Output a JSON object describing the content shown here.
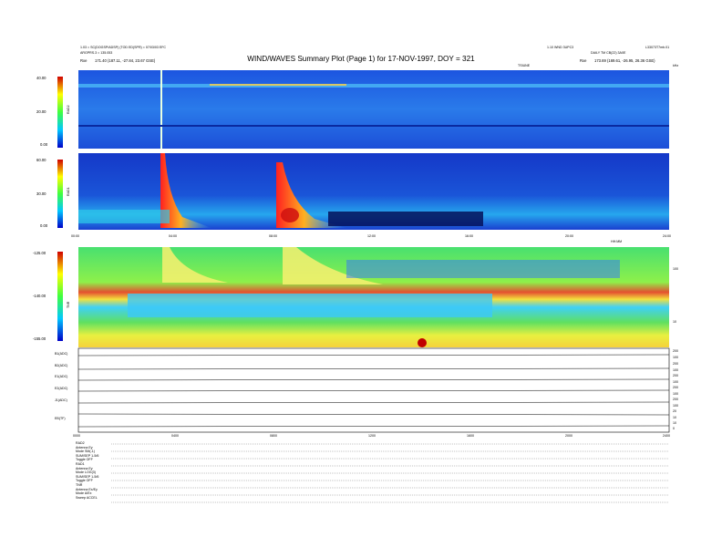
{
  "header": {
    "left_line1": "1.03 = SC(DOGSP/ADSP) (TOD ED(SPR) = 07/03/03 EFC",
    "left_line2": "ARGPRS.3 = 135.053",
    "left_line3_label": "Rxe",
    "left_line3_value": "171.40 (187.11, -27.84, 23.67 GSE)",
    "right_line1": "1.10 WND 3UPC3",
    "right_line1b": "L33073T7mb.01",
    "right_line2": "DAILY TM CB(22) 3A0E",
    "right_line3_label": "Rxe",
    "right_line3_value": "173.69 (169.61, -26.95, 26.36 GSE)",
    "title": "WIND/WAVES Summary Plot (Page 1) for 17-NOV-1997, DOY = 321",
    "units_top": "TSIUNE",
    "units_right": "kHz"
  },
  "rad2_panel": {
    "label": "RAD2",
    "ticks": [
      "40.00",
      "20.00",
      "0.00"
    ]
  },
  "rad1_panel": {
    "label": "RAD1",
    "ticks": [
      "60.00",
      "30.00",
      "0.00"
    ]
  },
  "tnr_panel": {
    "label": "TNR",
    "ticks": [
      "-125.00",
      "-140.00",
      "-155.00"
    ],
    "right_ticks": [
      "100",
      "10"
    ]
  },
  "time_axis_upper": [
    "00:00",
    "04:00",
    "08:00",
    "12:00",
    "16:00",
    "20:00",
    "24:00"
  ],
  "time_axis_lower": [
    "0000",
    "0400",
    "0800",
    "1200",
    "1600",
    "2000",
    "2400"
  ],
  "time_axis_label": "HH:MM",
  "line_panels": [
    {
      "label": "B1(ADC)",
      "ticks": [
        "200",
        "100"
      ]
    },
    {
      "label": "B2(ADC)",
      "ticks": [
        "200",
        "100"
      ]
    },
    {
      "label": "E1(ADC)",
      "ticks": [
        "200",
        "100"
      ]
    },
    {
      "label": "E2(ADC)",
      "ticks": [
        "200",
        "100"
      ]
    },
    {
      "label": "J1(ADC)",
      "ticks": [
        "200",
        "100"
      ]
    },
    {
      "label": "EB(TF)",
      "ticks": [
        "20",
        "10"
      ]
    },
    {
      "label": "",
      "ticks": [
        "10",
        "0"
      ]
    }
  ],
  "footer": [
    {
      "k": "RAD2",
      "v": ""
    },
    {
      "k": "Antenna",
      "v": "Ey"
    },
    {
      "k": "Mode",
      "v": "SM(-1)"
    },
    {
      "k": "SUM/SEP",
      "v": "1-5/6"
    },
    {
      "k": "Toggle",
      "v": "OFF"
    },
    {
      "k": "RAD1",
      "v": ""
    },
    {
      "k": "Antenna",
      "v": "Ey"
    },
    {
      "k": "Mode",
      "v": "LOG(3)"
    },
    {
      "k": "SUM/SEP",
      "v": "1-5/6"
    },
    {
      "k": "Toggle",
      "v": "OFF"
    },
    {
      "k": "TNR",
      "v": ""
    },
    {
      "k": "Antenna",
      "v": "Ex/Ey"
    },
    {
      "k": "Mode",
      "v": "A/Ex"
    },
    {
      "k": "Sweep",
      "v": "ACCEL"
    }
  ],
  "colors": {
    "spectrogram_background": "#1f3fd8",
    "burst_hot": "#d01010",
    "tnr_background": "#39c8ff",
    "tnr_band": "#f2e43a"
  },
  "chart_data": {
    "type": "heatmap",
    "title": "WIND/WAVES Summary Plot (Page 1) for 17-NOV-1997, DOY = 321",
    "x_range_hours": [
      0,
      24
    ],
    "panels": [
      {
        "name": "RAD2",
        "zlim": [
          0,
          40
        ]
      },
      {
        "name": "RAD1",
        "zlim": [
          0,
          60
        ]
      },
      {
        "name": "TNR",
        "zlim": [
          -155,
          -125
        ]
      }
    ],
    "features": [
      {
        "panel": "RAD1",
        "time_hours": 3.8,
        "description": "type III burst"
      },
      {
        "panel": "RAD1",
        "time_hours": 9.0,
        "description": "type III burst"
      },
      {
        "panel": "TNR",
        "time_hours": 3.8,
        "description": "burst"
      },
      {
        "panel": "TNR",
        "time_hours": 9.0,
        "description": "burst"
      }
    ]
  }
}
